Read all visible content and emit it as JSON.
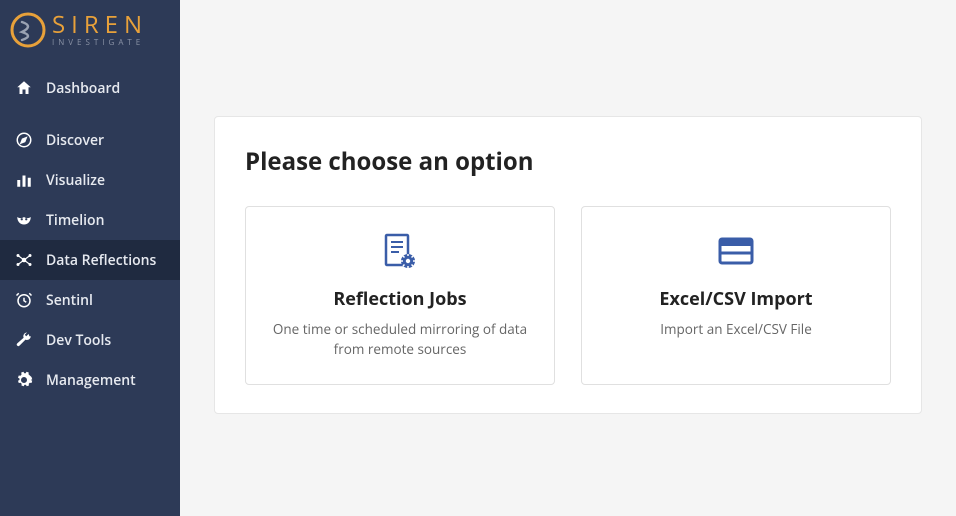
{
  "brand": {
    "main": "SIREN",
    "sub": "INVESTIGATE"
  },
  "sidebar": {
    "items": [
      {
        "label": "Dashboard",
        "icon": "home-icon",
        "active": false,
        "primary": true
      },
      {
        "label": "Discover",
        "icon": "compass-icon",
        "active": false,
        "primary": false
      },
      {
        "label": "Visualize",
        "icon": "bar-chart-icon",
        "active": false,
        "primary": false
      },
      {
        "label": "Timelion",
        "icon": "mask-icon",
        "active": false,
        "primary": false
      },
      {
        "label": "Data Reflections",
        "icon": "network-icon",
        "active": true,
        "primary": false
      },
      {
        "label": "Sentinl",
        "icon": "alarm-icon",
        "active": false,
        "primary": false
      },
      {
        "label": "Dev Tools",
        "icon": "wrench-icon",
        "active": false,
        "primary": false
      },
      {
        "label": "Management",
        "icon": "gear-icon",
        "active": false,
        "primary": false
      }
    ]
  },
  "main": {
    "title": "Please choose an option",
    "options": [
      {
        "icon": "document-gear-icon",
        "title": "Reflection Jobs",
        "description": "One time or scheduled mirroring of data from remote sources"
      },
      {
        "icon": "table-icon",
        "title": "Excel/CSV Import",
        "description": "Import an Excel/CSV File"
      }
    ]
  },
  "colors": {
    "accent": "#3a5da8",
    "brand": "#e8a13a"
  }
}
